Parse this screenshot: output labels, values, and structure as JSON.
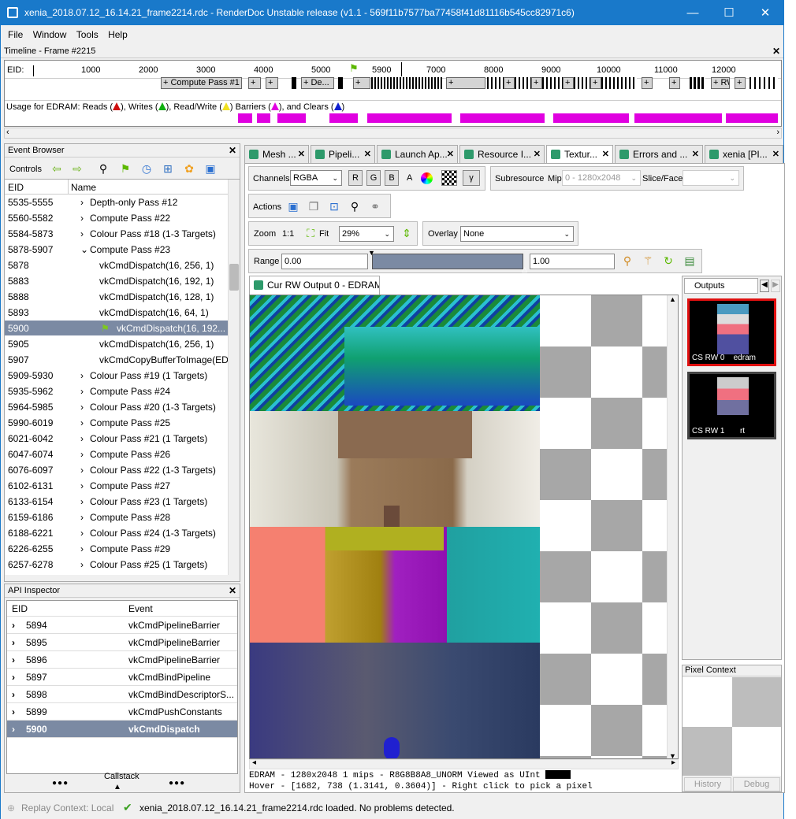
{
  "window": {
    "title": "xenia_2018.07.12_16.14.21_frame2214.rdc - RenderDoc Unstable release (v1.1 - 569f11b7577ba77458f41d81116b545cc82971c6)",
    "minimize": "—",
    "maximize": "☐",
    "close": "✕"
  },
  "menu": [
    "File",
    "Window",
    "Tools",
    "Help"
  ],
  "timeline": {
    "title": "Timeline - Frame #2215",
    "eid_label": "EID:",
    "ticks": [
      "1000",
      "2000",
      "3000",
      "4000",
      "5000",
      "5900",
      "7000",
      "8000",
      "9000",
      "10000",
      "11000",
      "12000"
    ],
    "blocks": [
      "+ Compute Pass #1",
      "+",
      "+",
      "+ De...",
      "+",
      "+",
      "+",
      "+",
      "+",
      "+",
      "+",
      "+",
      "+ RW",
      "+"
    ],
    "usage": {
      "prefix": "Usage for EDRAM: Reads (",
      "reads_end": "), Writes (",
      "writes_end": "), Read/Write (",
      "rw_end": ") Barriers (",
      "barriers_end": "), and Clears (",
      "clears_end": ")"
    },
    "colors": {
      "reads": "#d01010",
      "writes": "#10b010",
      "rw": "#f0e020",
      "barriers": "#e000e0",
      "clears": "#1020d0"
    }
  },
  "event_browser": {
    "title": "Event Browser",
    "controls_label": "Controls",
    "col_eid": "EID",
    "col_name": "Name",
    "rows": [
      {
        "eid": "5535-5555",
        "name": "Depth-only Pass #12",
        "exp": "›",
        "lvl": 0
      },
      {
        "eid": "5560-5582",
        "name": "Compute Pass #22",
        "exp": "›",
        "lvl": 0
      },
      {
        "eid": "5584-5873",
        "name": "Colour Pass #18 (1-3 Targets)",
        "exp": "›",
        "lvl": 0
      },
      {
        "eid": "5878-5907",
        "name": "Compute Pass #23",
        "exp": "⌄",
        "lvl": 0
      },
      {
        "eid": "5878",
        "name": "vkCmdDispatch(16, 256, 1)",
        "exp": "",
        "lvl": 1
      },
      {
        "eid": "5883",
        "name": "vkCmdDispatch(16, 192, 1)",
        "exp": "",
        "lvl": 1
      },
      {
        "eid": "5888",
        "name": "vkCmdDispatch(16, 128, 1)",
        "exp": "",
        "lvl": 1
      },
      {
        "eid": "5893",
        "name": "vkCmdDispatch(16, 64, 1)",
        "exp": "",
        "lvl": 1
      },
      {
        "eid": "5900",
        "name": "vkCmdDispatch(16, 192...",
        "exp": "",
        "lvl": 1,
        "sel": true
      },
      {
        "eid": "5905",
        "name": "vkCmdDispatch(16, 256, 1)",
        "exp": "",
        "lvl": 1
      },
      {
        "eid": "5907",
        "name": "vkCmdCopyBufferToImage(ED",
        "exp": "",
        "lvl": 1
      },
      {
        "eid": "5909-5930",
        "name": "Colour Pass #19 (1 Targets)",
        "exp": "›",
        "lvl": 0
      },
      {
        "eid": "5935-5962",
        "name": "Compute Pass #24",
        "exp": "›",
        "lvl": 0
      },
      {
        "eid": "5964-5985",
        "name": "Colour Pass #20 (1-3 Targets)",
        "exp": "›",
        "lvl": 0
      },
      {
        "eid": "5990-6019",
        "name": "Compute Pass #25",
        "exp": "›",
        "lvl": 0
      },
      {
        "eid": "6021-6042",
        "name": "Colour Pass #21 (1 Targets)",
        "exp": "›",
        "lvl": 0
      },
      {
        "eid": "6047-6074",
        "name": "Compute Pass #26",
        "exp": "›",
        "lvl": 0
      },
      {
        "eid": "6076-6097",
        "name": "Colour Pass #22 (1-3 Targets)",
        "exp": "›",
        "lvl": 0
      },
      {
        "eid": "6102-6131",
        "name": "Compute Pass #27",
        "exp": "›",
        "lvl": 0
      },
      {
        "eid": "6133-6154",
        "name": "Colour Pass #23 (1 Targets)",
        "exp": "›",
        "lvl": 0
      },
      {
        "eid": "6159-6186",
        "name": "Compute Pass #28",
        "exp": "›",
        "lvl": 0
      },
      {
        "eid": "6188-6221",
        "name": "Colour Pass #24 (1-3 Targets)",
        "exp": "›",
        "lvl": 0
      },
      {
        "eid": "6226-6255",
        "name": "Compute Pass #29",
        "exp": "›",
        "lvl": 0
      },
      {
        "eid": "6257-6278",
        "name": "Colour Pass #25 (1 Targets)",
        "exp": "›",
        "lvl": 0
      }
    ]
  },
  "api_inspector": {
    "title": "API Inspector",
    "col_eid": "EID",
    "col_event": "Event",
    "callstack": "Callstack",
    "dots": "●●●",
    "rows": [
      {
        "eid": "5894",
        "event": "vkCmdPipelineBarrier"
      },
      {
        "eid": "5895",
        "event": "vkCmdPipelineBarrier"
      },
      {
        "eid": "5896",
        "event": "vkCmdPipelineBarrier"
      },
      {
        "eid": "5897",
        "event": "vkCmdBindPipeline"
      },
      {
        "eid": "5898",
        "event": "vkCmdBindDescriptorS..."
      },
      {
        "eid": "5899",
        "event": "vkCmdPushConstants"
      },
      {
        "eid": "5900",
        "event": "vkCmdDispatch",
        "sel": true
      }
    ]
  },
  "tabs": [
    {
      "label": "Mesh ..."
    },
    {
      "label": "Pipeli..."
    },
    {
      "label": "Launch Ap..."
    },
    {
      "label": "Resource I..."
    },
    {
      "label": "Textur...",
      "active": true
    },
    {
      "label": "Errors and ..."
    },
    {
      "label": "xenia [PI..."
    }
  ],
  "texture_viewer": {
    "channels_label": "Channels",
    "channels_value": "RGBA",
    "r": "R",
    "g": "G",
    "b": "B",
    "a": "A",
    "gamma": "γ",
    "subresource_label": "Subresource",
    "mip_label": "Mip",
    "mip_value": "0 - 1280x2048",
    "slice_label": "Slice/Face",
    "slice_value": "",
    "actions_label": "Actions",
    "zoom_label": "Zoom",
    "zoom_11": "1:1",
    "fit_label": "Fit",
    "zoom_value": "29%",
    "overlay_label": "Overlay",
    "overlay_value": "None",
    "range_label": "Range",
    "range_min": "0.00",
    "range_max": "1.00",
    "output_tab": "Cur RW Output 0 - EDRAM",
    "status1": "EDRAM - 1280x2048 1 mips - R8G8B8A8_UNORM Viewed as UInt",
    "status2": "Hover - [1682,  738 (1.3141, 0.3604)] - Right click to pick a pixel",
    "outputs_label": "Outputs",
    "thumbs": [
      {
        "cap": "CS RW 0",
        "name": "edram"
      },
      {
        "cap": "CS RW 1",
        "name": "rt"
      }
    ],
    "pixel_context": "Pixel Context",
    "history": "History",
    "debug": "Debug"
  },
  "statusbar": {
    "replay": "Replay Context: Local",
    "message": "xenia_2018.07.12_16.14.21_frame2214.rdc loaded. No problems detected."
  }
}
